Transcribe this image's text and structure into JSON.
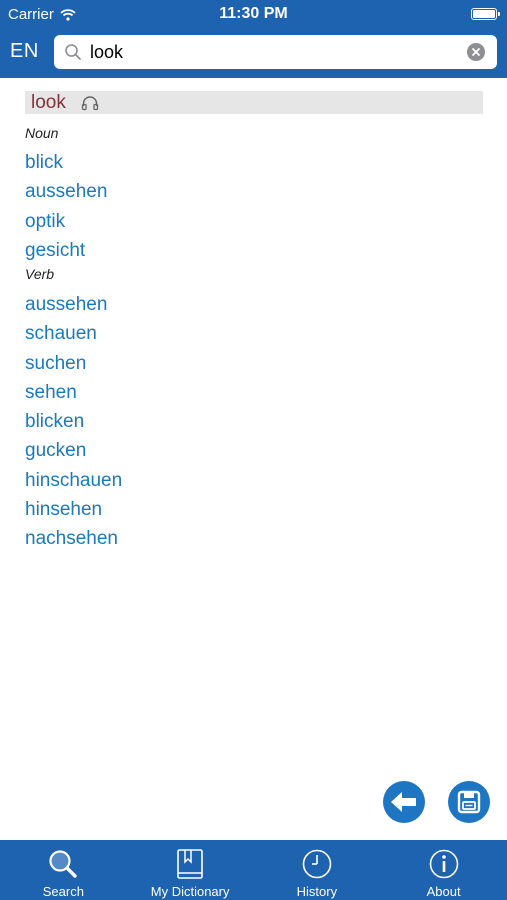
{
  "status_bar": {
    "carrier": "Carrier",
    "time": "11:30 PM"
  },
  "header": {
    "language": "EN",
    "search": {
      "value": "look",
      "placeholder": ""
    }
  },
  "entry": {
    "headword": "look",
    "sections": [
      {
        "pos": "Noun",
        "translations": [
          "blick",
          "aussehen",
          "optik",
          "gesicht"
        ]
      },
      {
        "pos": "Verb",
        "translations": [
          "aussehen",
          "schauen",
          "suchen",
          "sehen",
          "blicken",
          "gucken",
          "hinschauen",
          "hinsehen",
          "nachsehen"
        ]
      }
    ]
  },
  "actions": {
    "back_icon": "arrow-left-icon",
    "save_icon": "floppy-disk-icon"
  },
  "tabs": [
    {
      "label": "Search",
      "icon": "magnifier-icon"
    },
    {
      "label": "My Dictionary",
      "icon": "bookmark-book-icon"
    },
    {
      "label": "History",
      "icon": "clock-icon"
    },
    {
      "label": "About",
      "icon": "info-icon"
    }
  ],
  "colors": {
    "brand_blue": "#1e63b0",
    "link_blue": "#1a7abf",
    "headword_red": "#8b2f3c",
    "fab_blue": "#1e75c2"
  }
}
